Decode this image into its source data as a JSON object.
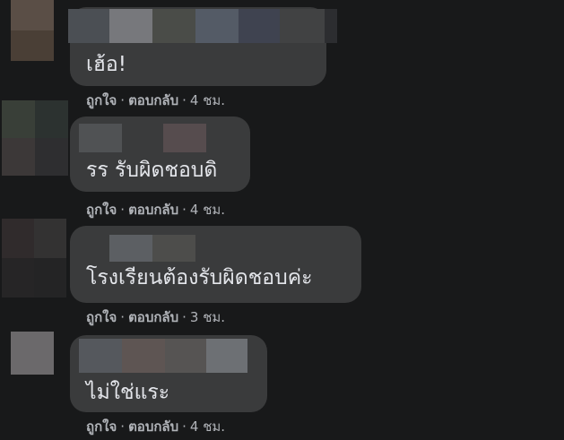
{
  "comments": [
    {
      "text": "เฮ้อ!",
      "like_label": "ถูกใจ",
      "reply_label": "ตอบกลับ",
      "separator": "·",
      "time": "4 ชม."
    },
    {
      "text": "รร รับผิดชอบดิ",
      "like_label": "ถูกใจ",
      "reply_label": "ตอบกลับ",
      "separator": "·",
      "time": "4 ชม."
    },
    {
      "text": "โรงเรียนต้องรับผิดชอบค่ะ",
      "like_label": "ถูกใจ",
      "reply_label": "ตอบกลับ",
      "separator": "·",
      "time": "3 ชม."
    },
    {
      "text": "ไม่ใช่แระ",
      "like_label": "ถูกใจ",
      "reply_label": "ตอบกลับ",
      "separator": "·",
      "time": "4 ชม."
    }
  ],
  "colors": {
    "background": "#18191a",
    "bubble": "#3a3b3c",
    "text": "#e4e6eb",
    "meta": "#b0b3b8"
  }
}
